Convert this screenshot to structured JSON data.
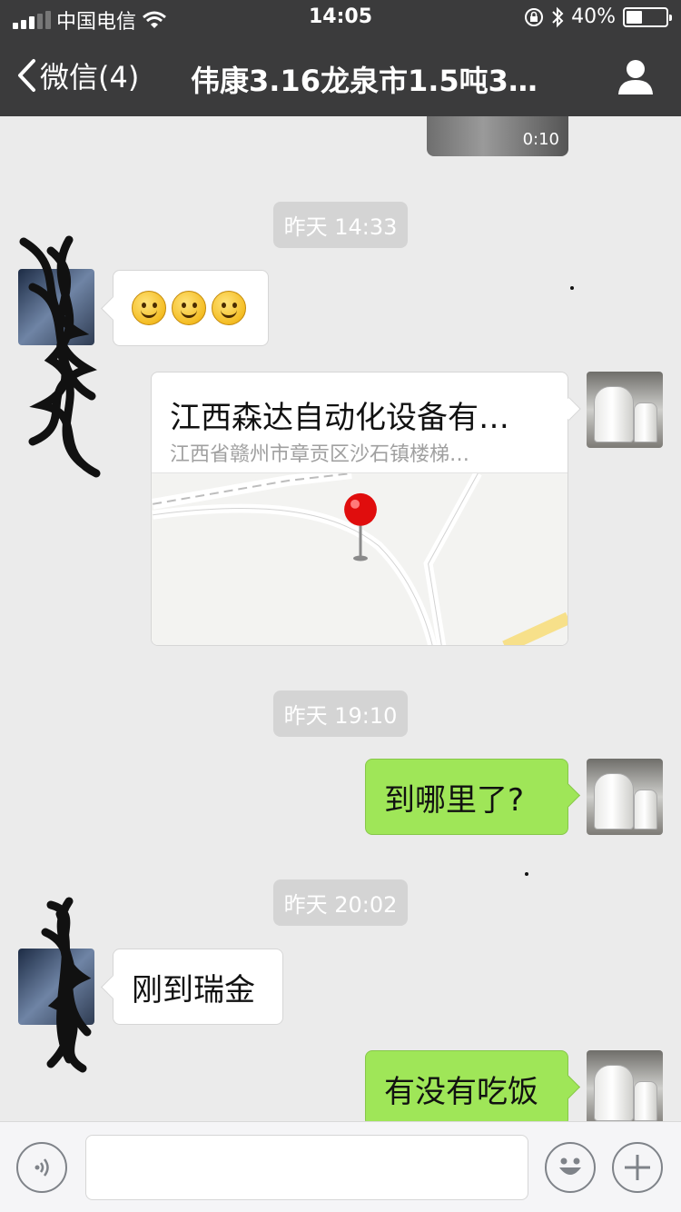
{
  "status_bar": {
    "carrier": "中国电信",
    "time": "14:05",
    "battery_text": "40%",
    "battery_level": 0.4
  },
  "nav": {
    "back_label": "微信(4)",
    "title": "伟康3.16龙泉市1.5吨3…"
  },
  "video": {
    "duration": "0:10"
  },
  "messages": {
    "time1": "昨天 14:33",
    "location_name": "江西森达自动化设备有…",
    "location_address": "江西省赣州市章贡区沙石镇楼梯…",
    "time2": "昨天 19:10",
    "msg_sent_1": "到哪里了?",
    "time3": "昨天 20:02",
    "msg_recv_1": "刚到瑞金",
    "msg_sent_2": "有没有吃饭"
  },
  "icons": {
    "back": "chevron-left-icon",
    "profile": "person-icon",
    "voice": "voice-icon",
    "emoji": "emoji-icon",
    "add": "plus-icon",
    "map_pin": "map-pin-icon"
  },
  "colors": {
    "header_bg": "#3b3b3c",
    "chat_bg": "#ebebeb",
    "sent_bubble": "#9fe658",
    "received_bubble": "#ffffff"
  }
}
